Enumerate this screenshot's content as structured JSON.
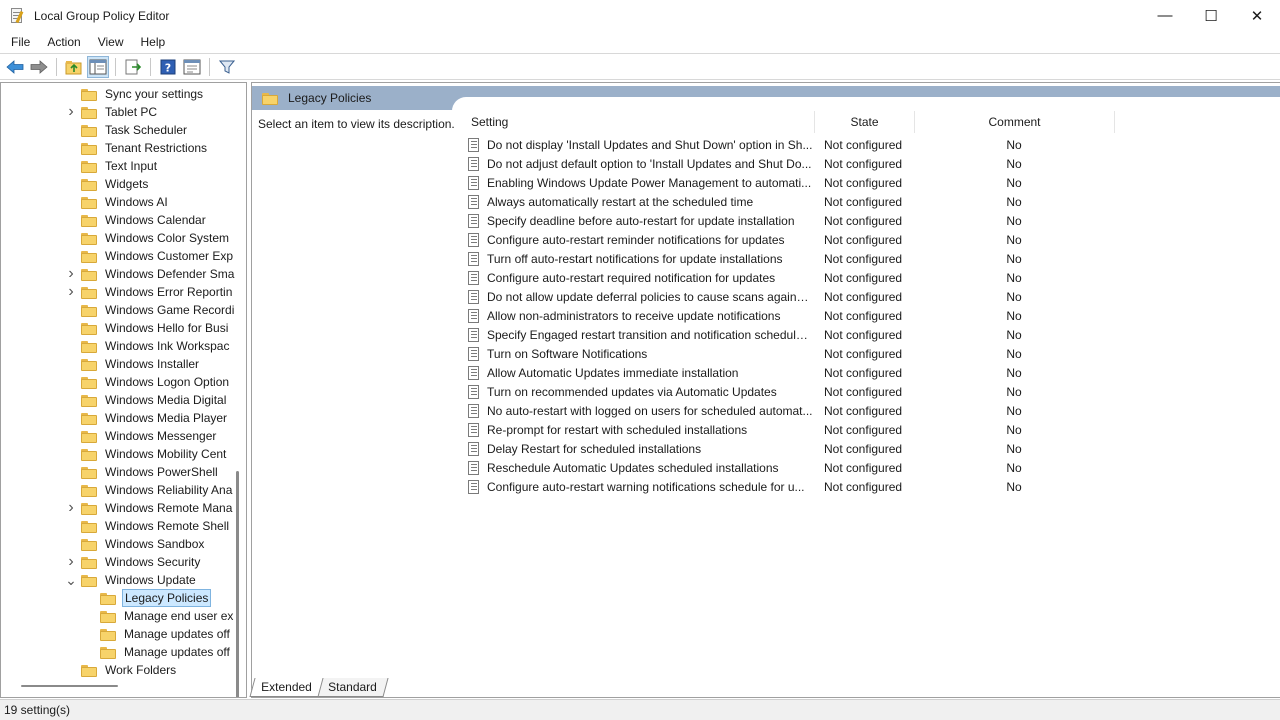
{
  "window": {
    "title": "Local Group Policy Editor",
    "minimize": "—",
    "maximize": "☐",
    "close": "✕"
  },
  "menu": [
    "File",
    "Action",
    "View",
    "Help"
  ],
  "toolbar": {
    "icons": [
      "back-arrow-icon",
      "forward-arrow-icon",
      "up-folder-icon",
      "show-hide-tree-icon",
      "export-list-icon",
      "help-icon",
      "properties-icon",
      "filter-icon"
    ]
  },
  "tree": {
    "items": [
      {
        "label": "Sync your settings",
        "level": 1,
        "expander": ""
      },
      {
        "label": "Tablet PC",
        "level": 1,
        "expander": ">"
      },
      {
        "label": "Task Scheduler",
        "level": 1,
        "expander": ""
      },
      {
        "label": "Tenant Restrictions",
        "level": 1,
        "expander": ""
      },
      {
        "label": "Text Input",
        "level": 1,
        "expander": ""
      },
      {
        "label": "Widgets",
        "level": 1,
        "expander": ""
      },
      {
        "label": "Windows AI",
        "level": 1,
        "expander": ""
      },
      {
        "label": "Windows Calendar",
        "level": 1,
        "expander": ""
      },
      {
        "label": "Windows Color System",
        "level": 1,
        "expander": ""
      },
      {
        "label": "Windows Customer Exp",
        "level": 1,
        "expander": ""
      },
      {
        "label": "Windows Defender Sma",
        "level": 1,
        "expander": ">"
      },
      {
        "label": "Windows Error Reportin",
        "level": 1,
        "expander": ">"
      },
      {
        "label": "Windows Game Recordi",
        "level": 1,
        "expander": ""
      },
      {
        "label": "Windows Hello for Busi",
        "level": 1,
        "expander": ""
      },
      {
        "label": "Windows Ink Workspac",
        "level": 1,
        "expander": ""
      },
      {
        "label": "Windows Installer",
        "level": 1,
        "expander": ""
      },
      {
        "label": "Windows Logon Option",
        "level": 1,
        "expander": ""
      },
      {
        "label": "Windows Media Digital",
        "level": 1,
        "expander": ""
      },
      {
        "label": "Windows Media Player",
        "level": 1,
        "expander": ""
      },
      {
        "label": "Windows Messenger",
        "level": 1,
        "expander": ""
      },
      {
        "label": "Windows Mobility Cent",
        "level": 1,
        "expander": ""
      },
      {
        "label": "Windows PowerShell",
        "level": 1,
        "expander": ""
      },
      {
        "label": "Windows Reliability Ana",
        "level": 1,
        "expander": ""
      },
      {
        "label": "Windows Remote Mana",
        "level": 1,
        "expander": ">"
      },
      {
        "label": "Windows Remote Shell",
        "level": 1,
        "expander": ""
      },
      {
        "label": "Windows Sandbox",
        "level": 1,
        "expander": ""
      },
      {
        "label": "Windows Security",
        "level": 1,
        "expander": ">"
      },
      {
        "label": "Windows Update",
        "level": 1,
        "expander": "v"
      },
      {
        "label": "Legacy Policies",
        "level": 2,
        "expander": "",
        "selected": true
      },
      {
        "label": "Manage end user ex",
        "level": 2,
        "expander": ""
      },
      {
        "label": "Manage updates off",
        "level": 2,
        "expander": ""
      },
      {
        "label": "Manage updates off",
        "level": 2,
        "expander": ""
      },
      {
        "label": "Work Folders",
        "level": 1,
        "expander": ""
      }
    ]
  },
  "details": {
    "header_title": "Legacy Policies",
    "description": "Select an item to view its description.",
    "columns": {
      "setting": "Setting",
      "state": "State",
      "comment": "Comment"
    },
    "rows": [
      {
        "name": "Do not display 'Install Updates and Shut Down' option in Sh...",
        "state": "Not configured",
        "comment": "No"
      },
      {
        "name": "Do not adjust default option to 'Install Updates and Shut Do...",
        "state": "Not configured",
        "comment": "No"
      },
      {
        "name": "Enabling Windows Update Power Management to automati...",
        "state": "Not configured",
        "comment": "No"
      },
      {
        "name": "Always automatically restart at the scheduled time",
        "state": "Not configured",
        "comment": "No"
      },
      {
        "name": "Specify deadline before auto-restart for update installation",
        "state": "Not configured",
        "comment": "No"
      },
      {
        "name": "Configure auto-restart reminder notifications for updates",
        "state": "Not configured",
        "comment": "No"
      },
      {
        "name": "Turn off auto-restart notifications for update installations",
        "state": "Not configured",
        "comment": "No"
      },
      {
        "name": "Configure auto-restart required notification for updates",
        "state": "Not configured",
        "comment": "No"
      },
      {
        "name": "Do not allow update deferral policies to cause scans against ...",
        "state": "Not configured",
        "comment": "No"
      },
      {
        "name": "Allow non-administrators to receive update notifications",
        "state": "Not configured",
        "comment": "No"
      },
      {
        "name": "Specify Engaged restart transition and notification schedule ...",
        "state": "Not configured",
        "comment": "No"
      },
      {
        "name": "Turn on Software Notifications",
        "state": "Not configured",
        "comment": "No"
      },
      {
        "name": "Allow Automatic Updates immediate installation",
        "state": "Not configured",
        "comment": "No"
      },
      {
        "name": "Turn on recommended updates via Automatic Updates",
        "state": "Not configured",
        "comment": "No"
      },
      {
        "name": "No auto-restart with logged on users for scheduled automat...",
        "state": "Not configured",
        "comment": "No"
      },
      {
        "name": "Re-prompt for restart with scheduled installations",
        "state": "Not configured",
        "comment": "No"
      },
      {
        "name": "Delay Restart for scheduled installations",
        "state": "Not configured",
        "comment": "No"
      },
      {
        "name": "Reschedule Automatic Updates scheduled installations",
        "state": "Not configured",
        "comment": "No"
      },
      {
        "name": "Configure auto-restart warning notifications schedule for u...",
        "state": "Not configured",
        "comment": "No"
      }
    ]
  },
  "tabs": [
    {
      "label": "Extended",
      "active": true
    },
    {
      "label": "Standard",
      "active": false
    }
  ],
  "status": {
    "text": "19 setting(s)"
  },
  "colors": {
    "header_bar": "#9bb0c9",
    "selection": "#cce8ff",
    "folder": "#f7d36a"
  }
}
